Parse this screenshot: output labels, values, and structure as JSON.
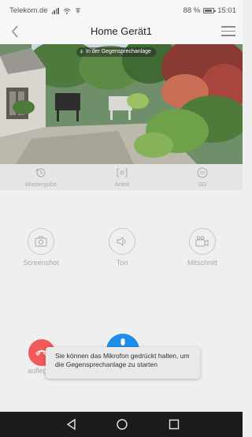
{
  "status_bar": {
    "carrier": "Telekom.de",
    "battery": "88 %",
    "time": "15:01"
  },
  "header": {
    "title": "Home Gerät1"
  },
  "video": {
    "call_status": "In der Gegensprechanlage"
  },
  "quick_actions": [
    {
      "label": "Wiedergabe",
      "icon": "history-icon"
    },
    {
      "label": "Anteil",
      "icon": "share-icon"
    },
    {
      "label": "SD",
      "icon": "sd-card-icon"
    }
  ],
  "actions": [
    {
      "label": "Screenshot",
      "icon": "camera-icon"
    },
    {
      "label": "Ton",
      "icon": "speaker-icon"
    },
    {
      "label": "Mitschnitt",
      "icon": "video-record-icon"
    }
  ],
  "controls": {
    "hangup_label": "aufleg",
    "toast": "Sie können das Mikrofon gedrückt halten, um die Gegensprechanlage zu starten"
  },
  "colors": {
    "hangup": "#f05a5a",
    "mic": "#1e8ee8",
    "nav_bar": "#1b1b1b"
  }
}
